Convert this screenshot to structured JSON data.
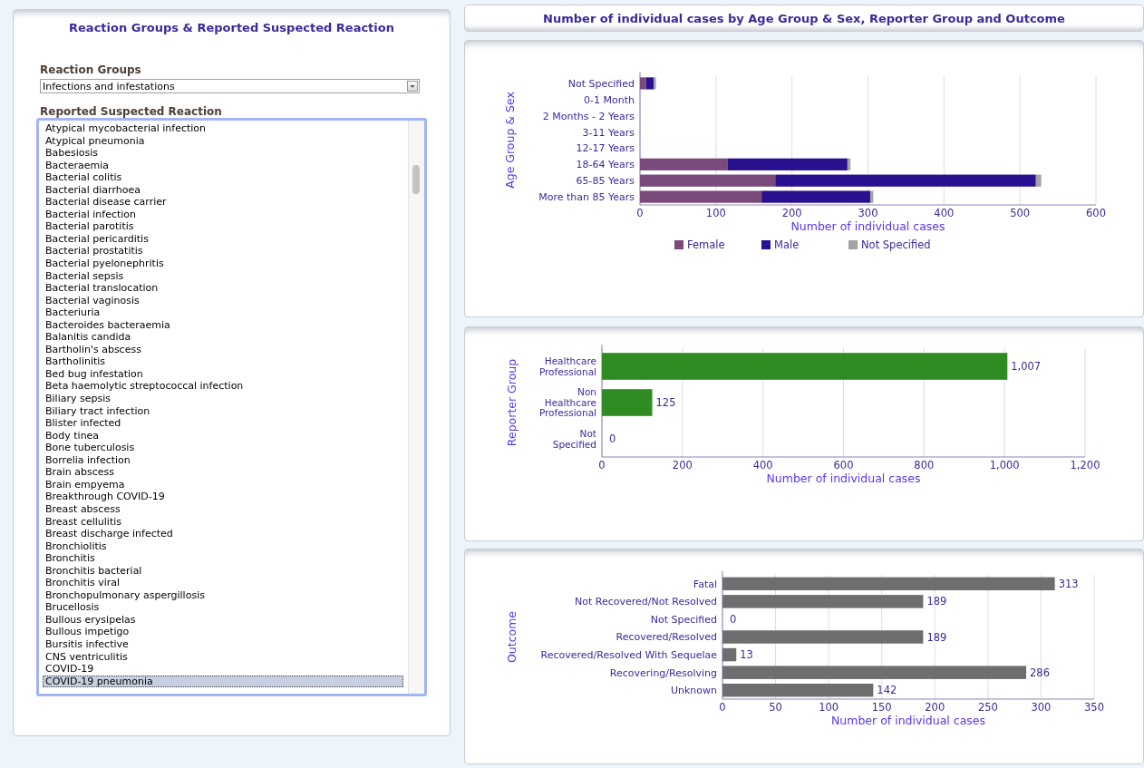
{
  "left_panel": {
    "title": "Reaction Groups & Reported Suspected Reaction",
    "reaction_groups": {
      "label": "Reaction Groups",
      "value": "Infections and infestations"
    },
    "reactions": {
      "label": "Reported Suspected Reaction",
      "items": [
        {
          "text": "Atypical mycobacterial infection",
          "selected": false
        },
        {
          "text": "Atypical pneumonia",
          "selected": false
        },
        {
          "text": "Babesiosis",
          "selected": false
        },
        {
          "text": "Bacteraemia",
          "selected": false
        },
        {
          "text": "Bacterial colitis",
          "selected": false
        },
        {
          "text": "Bacterial diarrhoea",
          "selected": false
        },
        {
          "text": "Bacterial disease carrier",
          "selected": false
        },
        {
          "text": "Bacterial infection",
          "selected": false
        },
        {
          "text": "Bacterial parotitis",
          "selected": false
        },
        {
          "text": "Bacterial pericarditis",
          "selected": false
        },
        {
          "text": "Bacterial prostatitis",
          "selected": false
        },
        {
          "text": "Bacterial pyelonephritis",
          "selected": false
        },
        {
          "text": "Bacterial sepsis",
          "selected": false
        },
        {
          "text": "Bacterial translocation",
          "selected": false
        },
        {
          "text": "Bacterial vaginosis",
          "selected": false
        },
        {
          "text": "Bacteriuria",
          "selected": false
        },
        {
          "text": "Bacteroides bacteraemia",
          "selected": false
        },
        {
          "text": "Balanitis candida",
          "selected": false
        },
        {
          "text": "Bartholin's abscess",
          "selected": false
        },
        {
          "text": "Bartholinitis",
          "selected": false
        },
        {
          "text": "Bed bug infestation",
          "selected": false
        },
        {
          "text": "Beta haemolytic streptococcal infection",
          "selected": false
        },
        {
          "text": "Biliary sepsis",
          "selected": false
        },
        {
          "text": "Biliary tract infection",
          "selected": false
        },
        {
          "text": "Blister infected",
          "selected": false
        },
        {
          "text": "Body tinea",
          "selected": false
        },
        {
          "text": "Bone tuberculosis",
          "selected": false
        },
        {
          "text": "Borrelia infection",
          "selected": false
        },
        {
          "text": "Brain abscess",
          "selected": false
        },
        {
          "text": "Brain empyema",
          "selected": false
        },
        {
          "text": "Breakthrough COVID-19",
          "selected": false
        },
        {
          "text": "Breast abscess",
          "selected": false
        },
        {
          "text": "Breast cellulitis",
          "selected": false
        },
        {
          "text": "Breast discharge infected",
          "selected": false
        },
        {
          "text": "Bronchiolitis",
          "selected": false
        },
        {
          "text": "Bronchitis",
          "selected": false
        },
        {
          "text": "Bronchitis bacterial",
          "selected": false
        },
        {
          "text": "Bronchitis viral",
          "selected": false
        },
        {
          "text": "Bronchopulmonary aspergillosis",
          "selected": false
        },
        {
          "text": "Brucellosis",
          "selected": false
        },
        {
          "text": "Bullous erysipelas",
          "selected": false
        },
        {
          "text": "Bullous impetigo",
          "selected": false
        },
        {
          "text": "Bursitis infective",
          "selected": false
        },
        {
          "text": "CNS ventriculitis",
          "selected": false
        },
        {
          "text": "COVID-19",
          "selected": false
        },
        {
          "text": "COVID-19 pneumonia",
          "selected": true
        }
      ]
    }
  },
  "charts_title": "Number of individual cases by Age Group & Sex, Reporter Group and Outcome",
  "charts": [
    {
      "chart_data": {
        "type": "bar",
        "orientation": "horizontal",
        "stacked": true,
        "xlabel": "Number of individual cases",
        "ylabel": "Age Group & Sex",
        "categories": [
          "Not Specified",
          "0-1 Month",
          "2 Months - 2 Years",
          "3-11 Years",
          "12-17 Years",
          "18-64 Years",
          "65-85 Years",
          "More than 85 Years"
        ],
        "series": [
          {
            "name": "Female",
            "color": "#7a4a7c",
            "values": [
              8,
              0,
              0,
              0,
              0,
              115,
              178,
              160
            ]
          },
          {
            "name": "Male",
            "color": "#2a1190",
            "values": [
              10,
              0,
              0,
              0,
              0,
              158,
              343,
              143
            ]
          },
          {
            "name": "Not Specified",
            "color": "#a4a4a4",
            "values": [
              3,
              0,
              0,
              0,
              0,
              4,
              7,
              4
            ]
          }
        ],
        "xlim": [
          0,
          600
        ],
        "xticks": [
          0,
          100,
          200,
          300,
          400,
          500,
          600
        ],
        "grid": true,
        "legend": true
      }
    },
    {
      "chart_data": {
        "type": "bar",
        "orientation": "horizontal",
        "xlabel": "Number of individual cases",
        "ylabel": "Reporter Group",
        "categories": [
          "Healthcare Professional",
          "Non Healthcare Professional",
          "Not Specified"
        ],
        "series": [
          {
            "color": "#2f8c22",
            "values": [
              1007,
              125,
              0
            ]
          }
        ],
        "xlim": [
          0,
          1200
        ],
        "xticks": [
          0,
          200,
          400,
          600,
          800,
          {
            "value": 1000,
            "label": "1,000"
          },
          {
            "value": 1200,
            "label": "1,200"
          }
        ],
        "value_labels": [
          "1,007",
          "125",
          "0"
        ],
        "grid": true
      }
    },
    {
      "chart_data": {
        "type": "bar",
        "orientation": "horizontal",
        "xlabel": "Number of individual cases",
        "ylabel": "Outcome",
        "categories": [
          "Fatal",
          "Not Recovered/Not Resolved",
          "Not Specified",
          "Recovered/Resolved",
          "Recovered/Resolved With Sequelae",
          "Recovering/Resolving",
          "Unknown"
        ],
        "series": [
          {
            "color": "#6e6e6e",
            "values": [
              313,
              189,
              0,
              189,
              13,
              286,
              142
            ]
          }
        ],
        "xlim": [
          0,
          350
        ],
        "xticks": [
          0,
          50,
          100,
          150,
          200,
          250,
          300,
          350
        ],
        "value_labels": [
          "313",
          "189",
          "0",
          "189",
          "13",
          "286",
          "142"
        ],
        "grid": true
      }
    }
  ]
}
